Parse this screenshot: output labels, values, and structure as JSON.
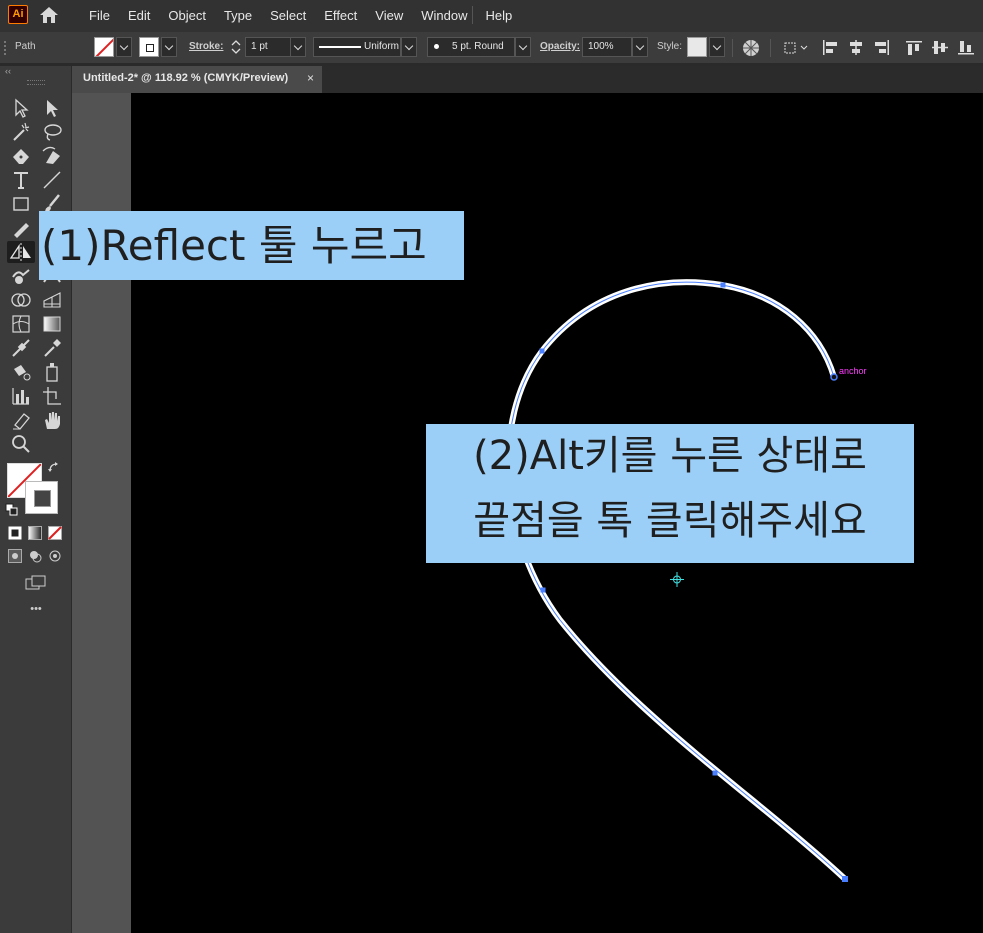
{
  "app": {
    "logo_text": "Ai"
  },
  "menu": [
    "File",
    "Edit",
    "Object",
    "Type",
    "Select",
    "Effect",
    "View",
    "Window",
    "Help"
  ],
  "control_bar": {
    "selection_label": "Path",
    "stroke_label": "Stroke:",
    "stroke_weight": "1 pt",
    "stroke_profile": "Uniform",
    "brush": "5 pt. Round",
    "opacity_label": "Opacity:",
    "opacity_value": "100%",
    "style_label": "Style:"
  },
  "document_tab": {
    "title": "Untitled-2* @ 118.92 % (CMYK/Preview)",
    "close": "×"
  },
  "toolbar": {
    "collapse": "‹‹",
    "more": "•••"
  },
  "canvas": {
    "anchor_hint": "anchor"
  },
  "callouts": {
    "step1": "(1)Reflect 툴 누르고",
    "step2_line1": "(2)Alt키를 누른 상태로",
    "step2_line2": "끝점을 톡 클릭해주세요"
  },
  "colors": {
    "ui_dark": "#323232",
    "artboard": "#000000",
    "callout_bg": "#9ccff7",
    "anchor_hint": "#ff3bff",
    "path_selection": "#4a7fff"
  }
}
